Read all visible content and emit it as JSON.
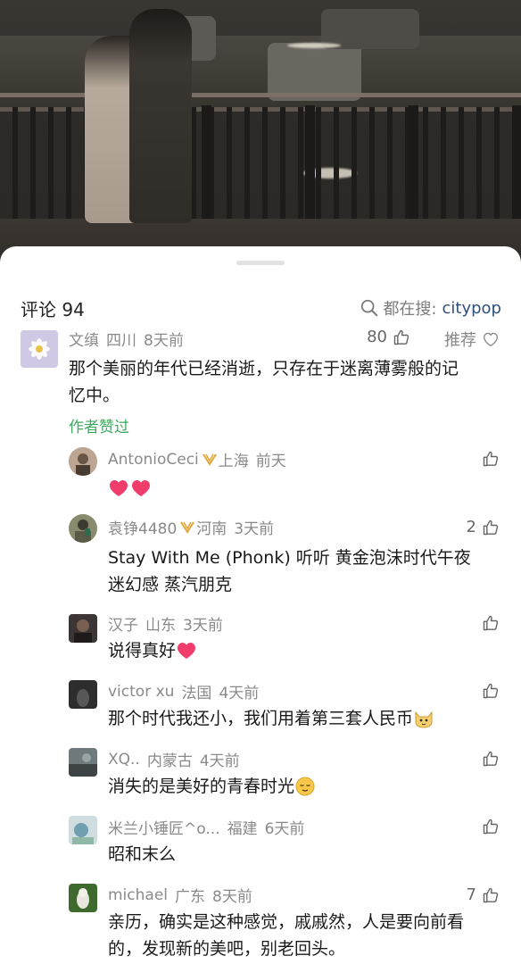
{
  "sheet": {
    "title": "评论 94"
  },
  "search": {
    "prefix": "都在搜:",
    "keyword": "citypop"
  },
  "top_comment": {
    "user": "文缜",
    "location": "四川",
    "time": "8天前",
    "likes": "80",
    "recommend_label": "推荐",
    "text_line1": "那个美丽的年代已经消逝，只存在于迷离薄雾般的记",
    "text_line2": "忆中。",
    "author_liked": "作者赞过"
  },
  "replies": [
    {
      "user": "AntonioCeci",
      "location": "上海",
      "time": "前天",
      "likes": "",
      "text": ""
    },
    {
      "user": "袁铮4480",
      "location": "河南",
      "time": "3天前",
      "likes": "2",
      "text_line1": "Stay With Me (Phonk) 听听 黄金泡沫时代午夜",
      "text_line2": "迷幻感 蒸汽朋克"
    },
    {
      "user": "汉子",
      "location": "山东",
      "time": "3天前",
      "likes": "",
      "text": "说得真好"
    },
    {
      "user": "victor xu",
      "location": "法国",
      "time": "4天前",
      "likes": "",
      "text": "那个时代我还小，我们用着第三套人民币"
    },
    {
      "user": "XQ..",
      "location": "内蒙古",
      "time": "4天前",
      "likes": "",
      "text": "消失的是美好的青春时光"
    },
    {
      "user": "米兰小锤匠^o...",
      "location": "福建",
      "time": "6天前",
      "likes": "",
      "text": "昭和末么"
    },
    {
      "user": "michael",
      "location": "广东",
      "time": "8天前",
      "likes": "7",
      "text_line1": "亲历，确实是这种感觉，戚戚然，人是要向前看",
      "text_line2": "的，发现新的美吧，别老回头。"
    }
  ],
  "colors": {
    "accent_green": "#3ea85f",
    "link_blue": "#2e4f7c",
    "badge_gold": "#e0a63a",
    "heart_pink": "#f03d6b"
  }
}
